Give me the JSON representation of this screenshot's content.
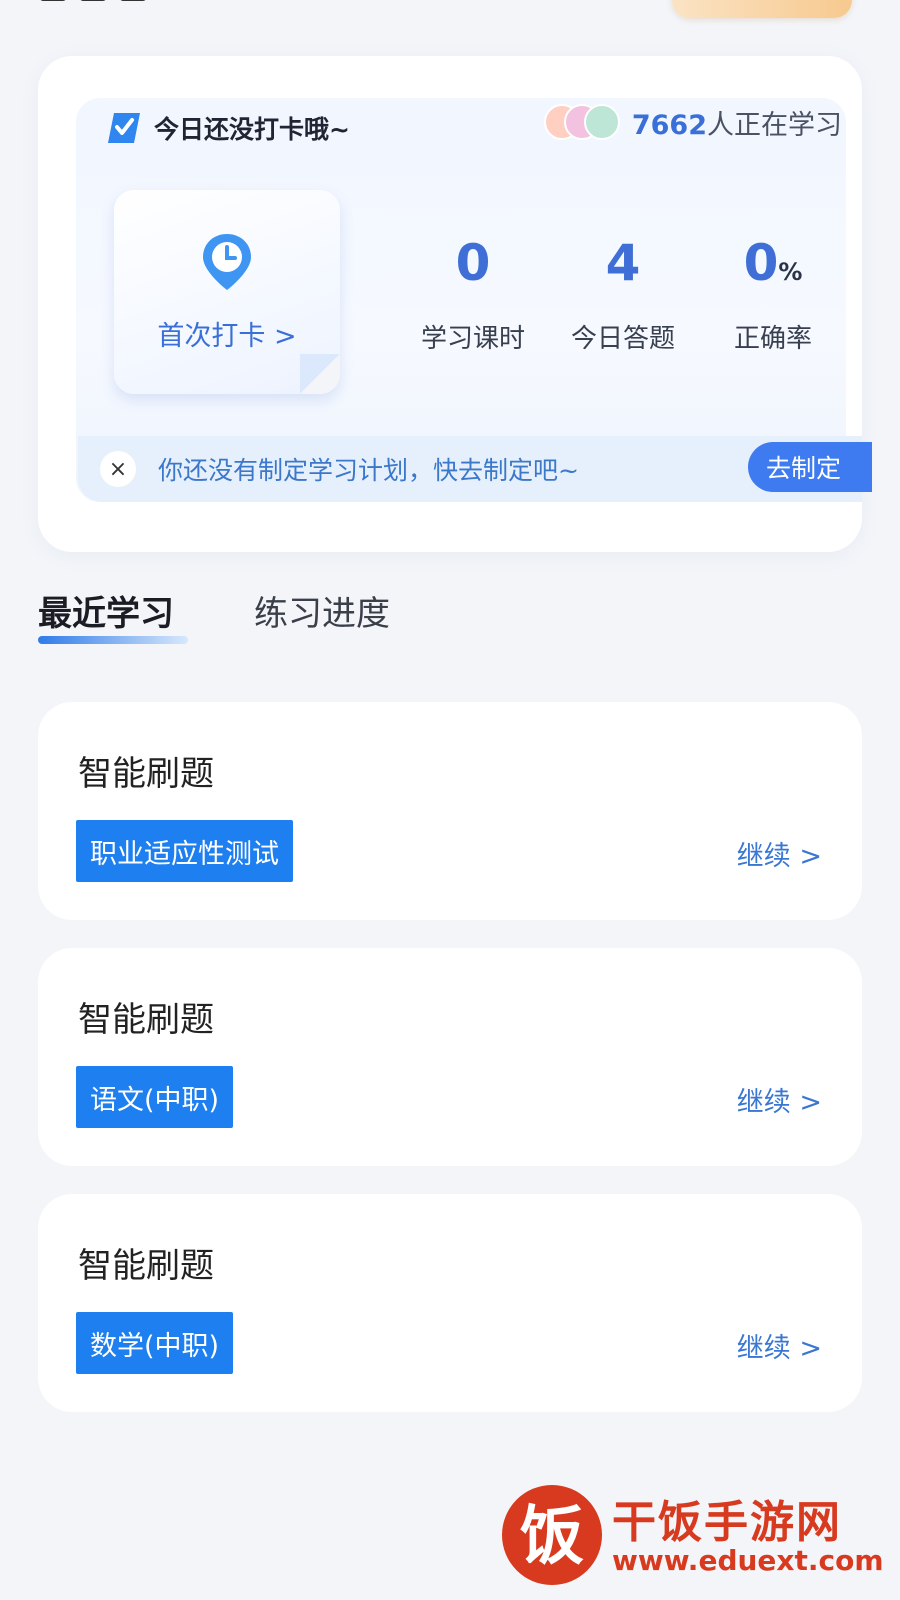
{
  "checkin": {
    "status_text": "今日还没打卡哦~",
    "learner_count": "7662",
    "learner_label": "人正在学习",
    "first_checkin_label": "首次打卡 >"
  },
  "stats": [
    {
      "value": "0",
      "unit": "",
      "label": "学习课时"
    },
    {
      "value": "4",
      "unit": "",
      "label": "今日答题"
    },
    {
      "value": "0",
      "unit": "%",
      "label": "正确率"
    }
  ],
  "plan": {
    "close_symbol": "×",
    "message": "你还没有制定学习计划，快去制定吧~",
    "button_label": "去制定"
  },
  "tabs": [
    {
      "label": "最近学习",
      "active": true
    },
    {
      "label": "练习进度",
      "active": false
    }
  ],
  "study_items": [
    {
      "title": "智能刷题",
      "tag": "职业适应性测试",
      "action": "继续 >"
    },
    {
      "title": "智能刷题",
      "tag": "语文(中职)",
      "action": "继续 >"
    },
    {
      "title": "智能刷题",
      "tag": "数学(中职)",
      "action": "继续 >"
    }
  ],
  "watermark": {
    "logo_char": "饭",
    "name": "干饭手游网",
    "url": "www.eduext.com"
  },
  "colors": {
    "accent": "#3f6fd6",
    "tag_blue": "#1e7ff0",
    "watermark_red": "#d83a1f"
  },
  "icons": [
    "checkin-ticket-icon",
    "clock-pin-icon",
    "close-icon",
    "chevron-right-icon"
  ]
}
